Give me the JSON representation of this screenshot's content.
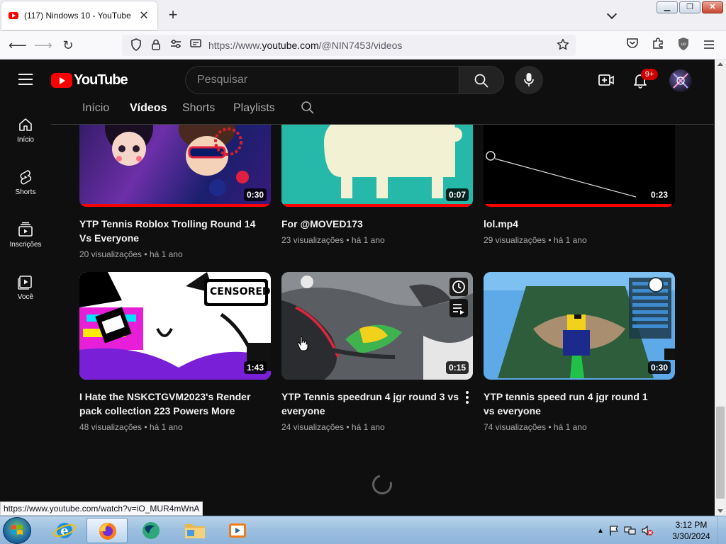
{
  "browser": {
    "tab_title": "(117) Nindows 10 - YouTube",
    "url_prefix": "https://www.",
    "url_host": "youtube.com",
    "url_path": "/@NIN7453/videos",
    "status_url": "https://www.youtube.com/watch?v=iO_MUR4mWnA"
  },
  "header": {
    "logo_text": "YouTube",
    "search_placeholder": "Pesquisar",
    "notification_count": "9+"
  },
  "channel_tabs": [
    "Início",
    "Vídeos",
    "Shorts",
    "Playlists"
  ],
  "active_tab_index": 1,
  "rail": [
    {
      "label": "Início",
      "icon": "home-icon"
    },
    {
      "label": "Shorts",
      "icon": "shorts-icon"
    },
    {
      "label": "Inscrições",
      "icon": "subscriptions-icon"
    },
    {
      "label": "Você",
      "icon": "you-icon"
    }
  ],
  "videos": [
    {
      "title": "YTP Tennis Roblox Trolling Round 14 Vs Everyone",
      "meta": "20 visualizações • há 1 ano",
      "duration": "0:30",
      "progress": 1.0
    },
    {
      "title": "For @MOVED173",
      "meta": "23 visualizações • há 1 ano",
      "duration": "0:07",
      "progress": 1.0
    },
    {
      "title": "lol.mp4",
      "meta": "29 visualizações • há 1 ano",
      "duration": "0:23",
      "progress": 0.98
    },
    {
      "title": "I Hate the NSKCTGVM2023's Render pack collection 223 Powers More",
      "meta": "48 visualizações • há 1 ano",
      "duration": "1:43",
      "progress": 0
    },
    {
      "title": "YTP Tennis speedrun 4 jgr round 3 vs everyone",
      "meta": "24 visualizações • há 1 ano",
      "duration": "0:15",
      "progress": 0
    },
    {
      "title": "YTP tennis speed run 4 jgr round 1 vs everyone",
      "meta": "74 visualizações • há 1 ano",
      "duration": "0:30",
      "progress": 0
    }
  ],
  "thumb_labels": {
    "censored": "CENSORED"
  },
  "taskbar": {
    "time": "3:12 PM",
    "date": "3/30/2024"
  },
  "colors": {
    "accent": "#ff0000",
    "background": "#0f0f0f"
  }
}
